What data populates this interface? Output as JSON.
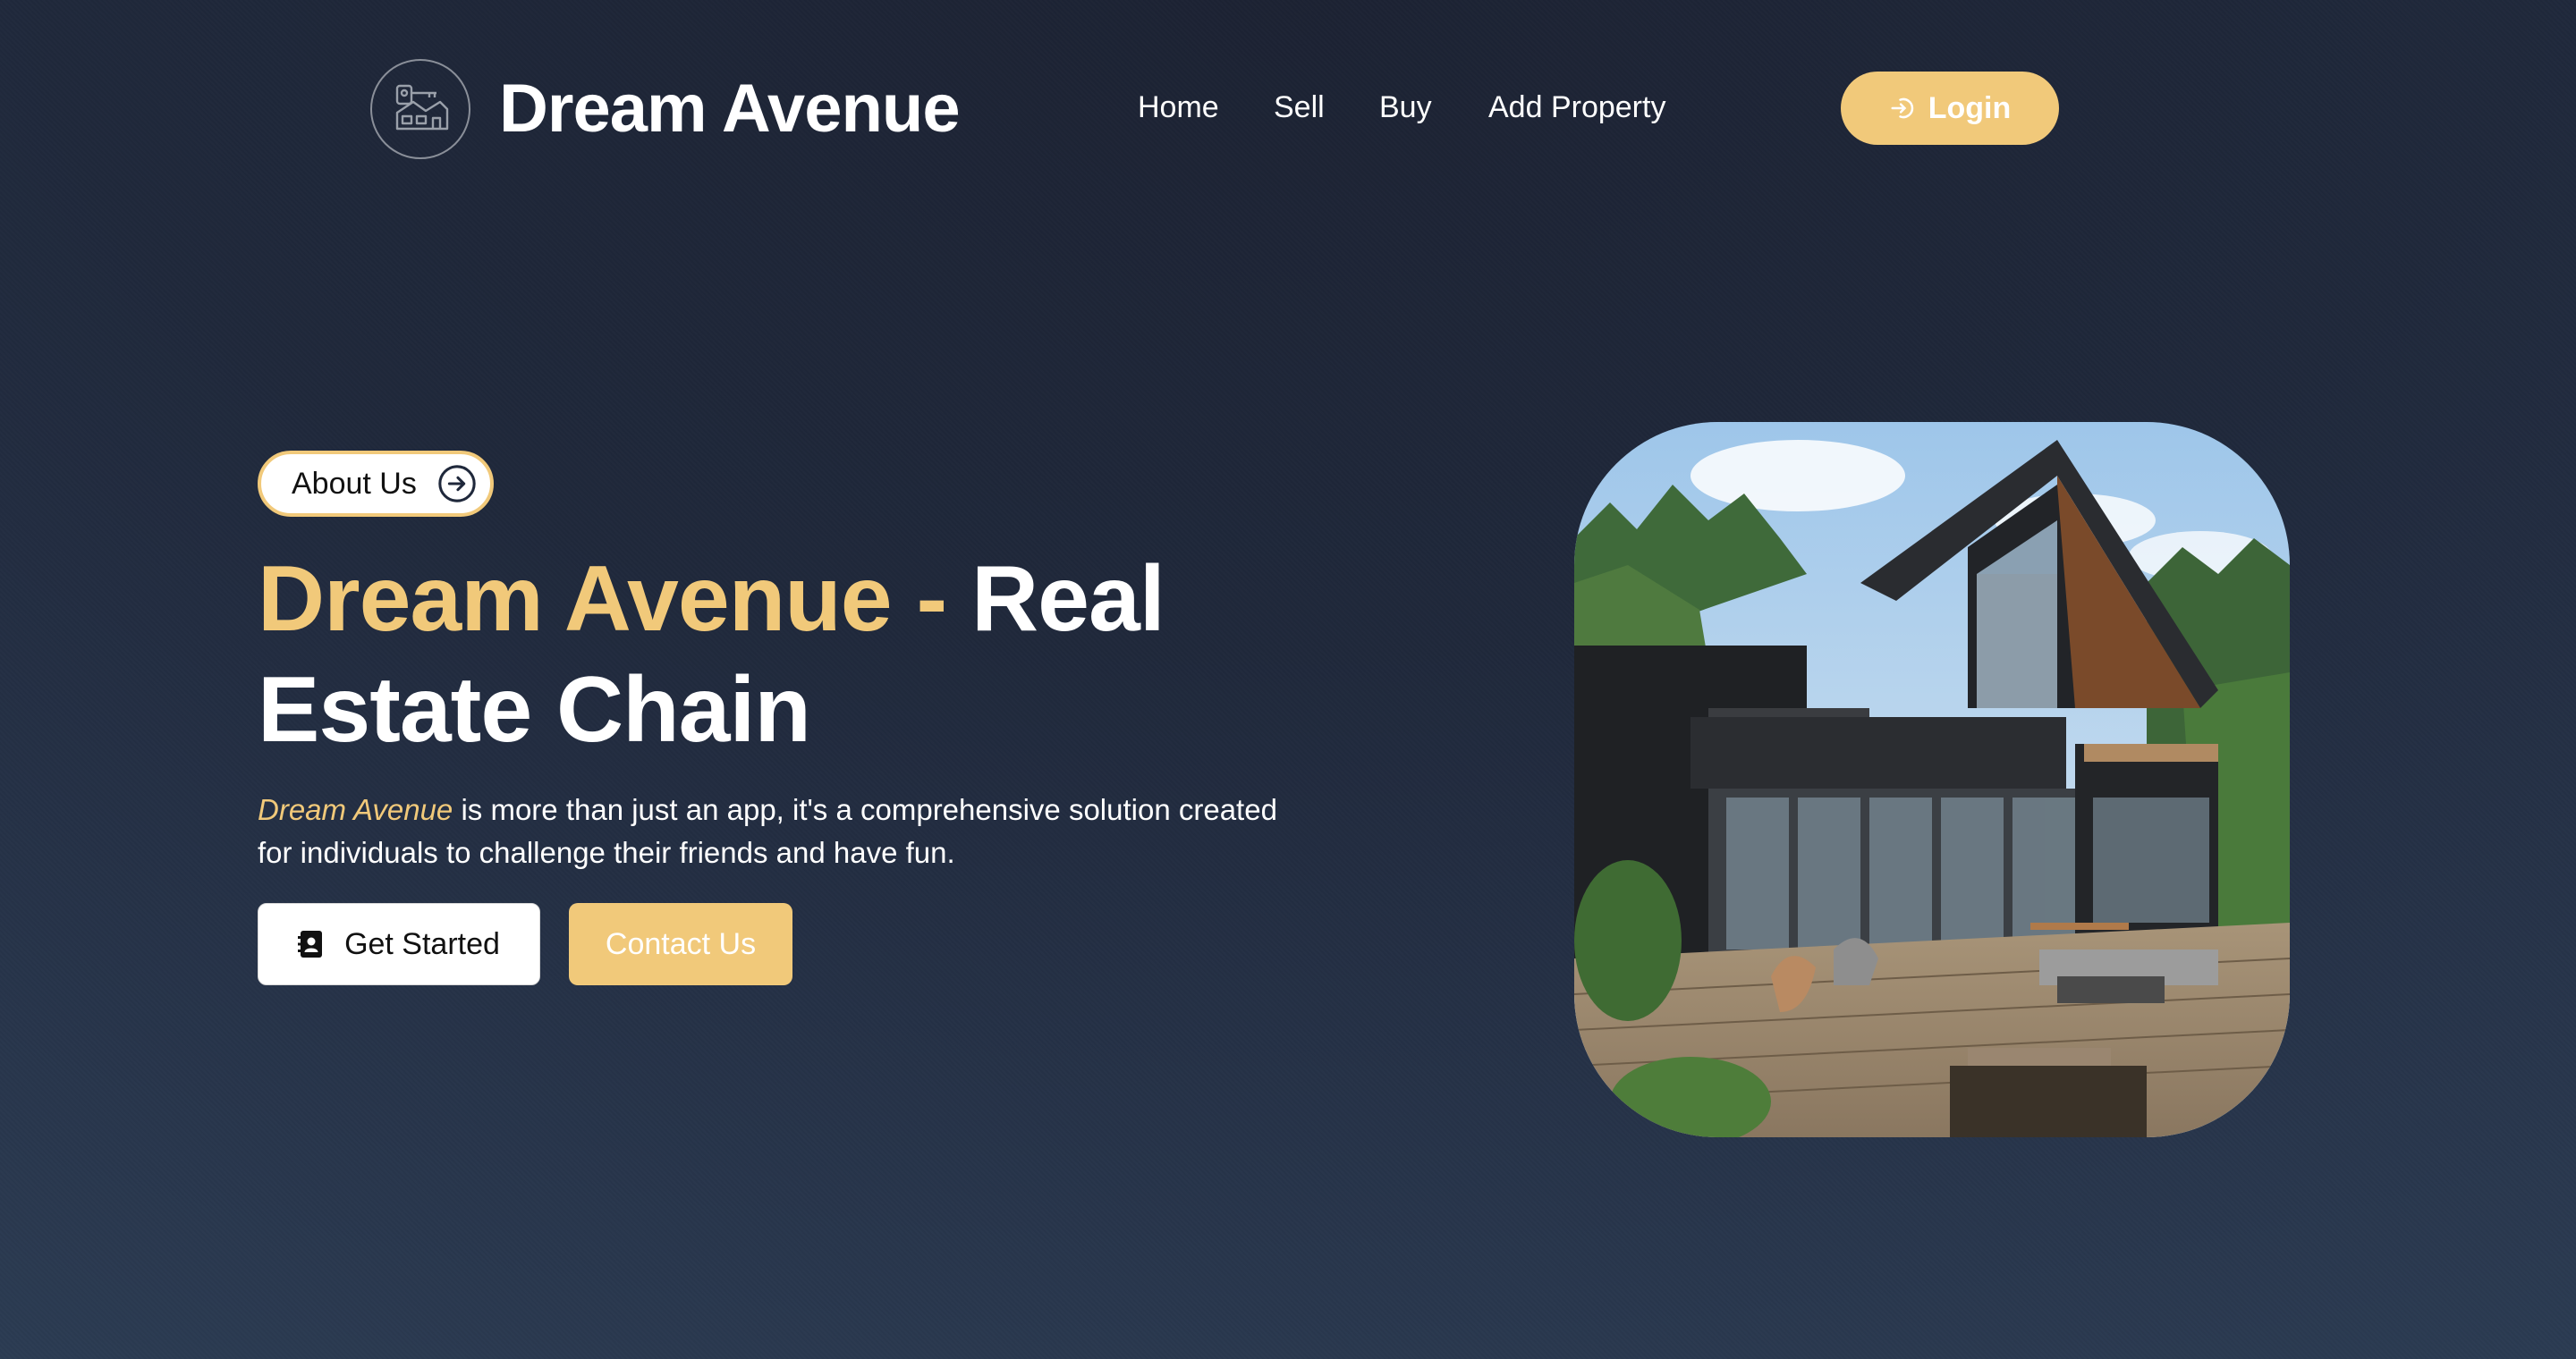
{
  "header": {
    "brand_name": "Dream Avenue",
    "nav": [
      "Home",
      "Sell",
      "Buy",
      "Add Property"
    ],
    "login_label": "Login"
  },
  "hero": {
    "about_label": "About Us",
    "title_accent": "Dream Avenue -",
    "title_rest": "Real Estate Chain",
    "desc_accent": "Dream Avenue",
    "desc_rest": " is more than just an app, it's a comprehensive solution created for individuals to challenge their friends and have fun.",
    "get_started_label": "Get Started",
    "contact_label": "Contact Us"
  },
  "colors": {
    "accent": "#f1c97a",
    "background": "#1f283b",
    "text": "#ffffff"
  },
  "icons": {
    "logo": "house-key-icon",
    "login": "login-icon",
    "about": "arrow-right-circle-icon",
    "get_started": "contact-book-icon"
  }
}
